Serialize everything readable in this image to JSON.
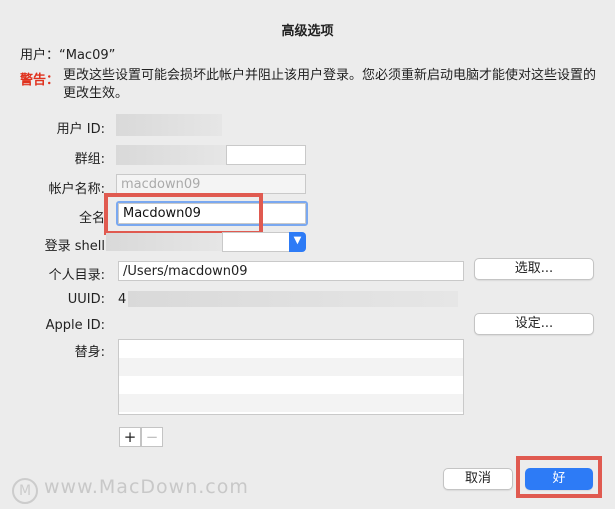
{
  "dialog": {
    "title": "高级选项",
    "user_line": "用户：“Mac09”",
    "warning_label": "警告：",
    "warning_text": "更改这些设置可能会损坏此帐户并阻止该用户登录。您必须重新启动电脑才能使对这些设置的更改生效。"
  },
  "fields": {
    "user_id_label": "用户 ID:",
    "group_label": "群组:",
    "account_name_label": "帐户名称:",
    "account_name_value": "macdown09",
    "full_name_label": "全名",
    "full_name_value": "Macdown09",
    "login_shell_label": "登录 shell",
    "home_dir_label": "个人目录:",
    "home_dir_value": "/Users/macdown09",
    "choose_label": "选取...",
    "uuid_label": "UUID:",
    "uuid_value": "4",
    "apple_id_label": "Apple ID:",
    "set_label": "设定...",
    "aliases_label": "替身:"
  },
  "aliases": [
    "",
    "",
    "",
    ""
  ],
  "buttons": {
    "add": "+",
    "remove": "−",
    "cancel": "取消",
    "ok": "好"
  },
  "watermark": "www.MacDown.com",
  "colors": {
    "accent": "#2d7bf6",
    "warning": "#e0321e",
    "highlight": "#e05a50"
  }
}
